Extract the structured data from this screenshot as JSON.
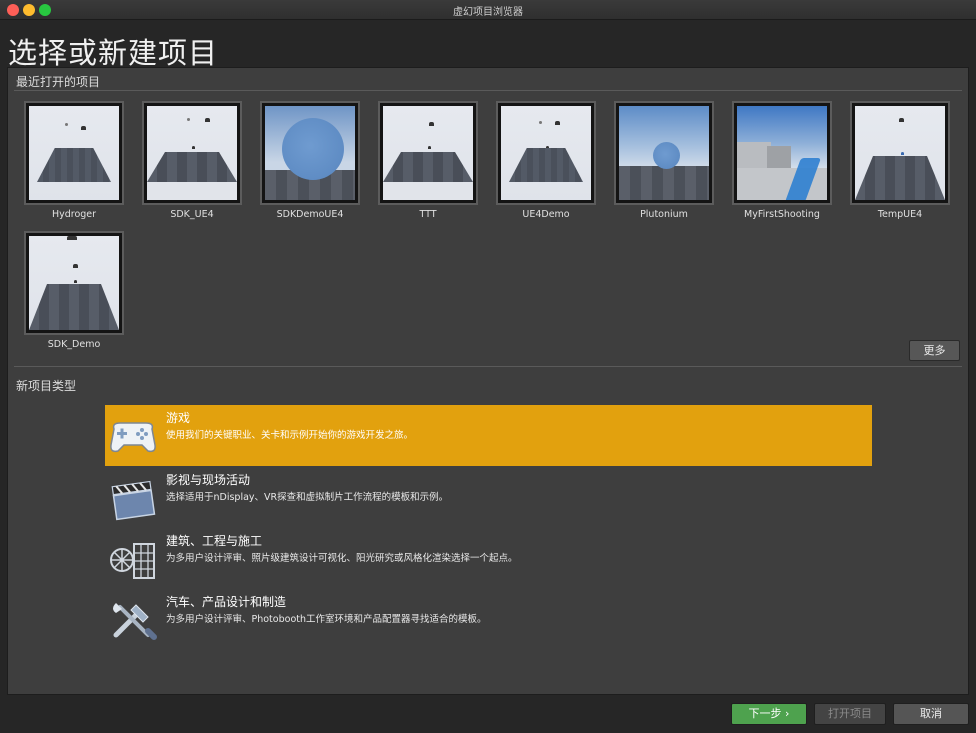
{
  "window": {
    "title": "虚幻项目浏览器"
  },
  "page_title": "选择或新建项目",
  "recent": {
    "label": "最近打开的项目",
    "more_label": "更多",
    "projects": [
      {
        "name": "Hydroger"
      },
      {
        "name": "SDK_UE4"
      },
      {
        "name": "SDKDemoUE4"
      },
      {
        "name": "TTT"
      },
      {
        "name": "UE4Demo"
      },
      {
        "name": "Plutonium"
      },
      {
        "name": "MyFirstShooting"
      },
      {
        "name": "TempUE4"
      },
      {
        "name": "SDK_Demo"
      }
    ]
  },
  "new_project": {
    "label": "新项目类型",
    "categories": [
      {
        "title": "游戏",
        "desc": "使用我们的关键职业、关卡和示例开始你的游戏开发之旅。",
        "icon": "gamepad-icon",
        "selected": true
      },
      {
        "title": "影视与现场活动",
        "desc": "选择适用于nDisplay、VR探查和虚拟制片工作流程的模板和示例。",
        "icon": "clapperboard-icon",
        "selected": false
      },
      {
        "title": "建筑、工程与施工",
        "desc": "为多用户设计评审、照片级建筑设计可视化、阳光研究或风格化渲染选择一个起点。",
        "icon": "architecture-icon",
        "selected": false
      },
      {
        "title": "汽车、产品设计和制造",
        "desc": "为多用户设计评审、Photobooth工作室环境和产品配置器寻找适合的模板。",
        "icon": "tools-icon",
        "selected": false
      }
    ]
  },
  "buttons": {
    "next": "下一步 ›",
    "open": "打开项目",
    "cancel": "取消"
  },
  "colors": {
    "selected_category": "#e2a10e",
    "next_button": "#4ea24e"
  }
}
